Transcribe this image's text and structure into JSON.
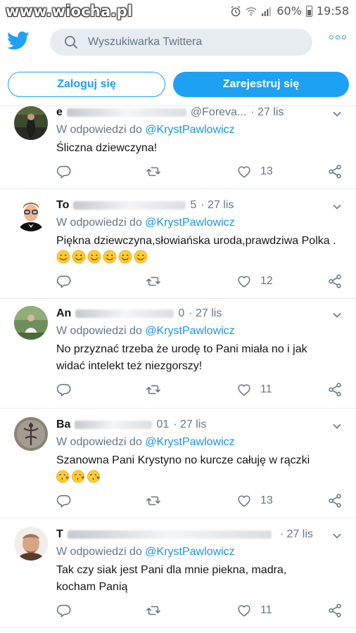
{
  "status_bar": {
    "watermark": "www.wiocha.pl",
    "battery": "60%",
    "time": "19:58"
  },
  "header": {
    "search_placeholder": "Wyszukiwarka Twittera"
  },
  "auth": {
    "login_label": "Zaloguj się",
    "signup_label": "Zarejestruj się"
  },
  "colors": {
    "accent": "#1da1f2",
    "mention": "#1b95e0",
    "muted": "#657786",
    "divider": "#e6ecf0"
  },
  "tweets": [
    {
      "name": "e",
      "handle": "@Foreva...",
      "time": "· 27 lis",
      "reply_prefix": "W odpowiedzi do",
      "reply_to": "@KrystPawlowicz",
      "text": "Śliczna dziewczyna!",
      "emojis": [],
      "likes": "13"
    },
    {
      "name": "To",
      "handle": "5",
      "time": "· 27 lis",
      "reply_prefix": "W odpowiedzi do",
      "reply_to": "@KrystPawlowicz",
      "text": "Piękna dziewczyna,słowiańska uroda,prawdziwa Polka .",
      "emojis": [
        "smiling-face-icon",
        "smiling-face-icon",
        "smiling-face-icon",
        "smiling-face-icon",
        "smiling-face-icon",
        "smiling-face-icon"
      ],
      "likes": "12"
    },
    {
      "name": "An",
      "handle": "0",
      "time": "· 27 lis",
      "reply_prefix": "W odpowiedzi do",
      "reply_to": "@KrystPawlowicz",
      "text": "No przyznać trzeba że urodę to Pani miała no i jak widać intelekt też niezgorszy!",
      "emojis": [],
      "likes": "11"
    },
    {
      "name": "Ba",
      "handle": "01",
      "time": "· 27 lis",
      "reply_prefix": "W odpowiedzi do",
      "reply_to": "@KrystPawlowicz",
      "text": "Szanowna Pani Krystyno no kurcze całuję w rączki",
      "emojis": [
        "kissing-face-icon",
        "kissing-face-icon",
        "kissing-face-icon"
      ],
      "likes": "13"
    },
    {
      "name": "T",
      "handle": "",
      "time": "· 27 lis",
      "reply_prefix": "W odpowiedzi do",
      "reply_to": "@KrystPawlowicz",
      "text": "Tak czy siak jest Pani dla mnie piekna, madra, kocham Panią",
      "emojis": [],
      "likes": "11"
    }
  ]
}
